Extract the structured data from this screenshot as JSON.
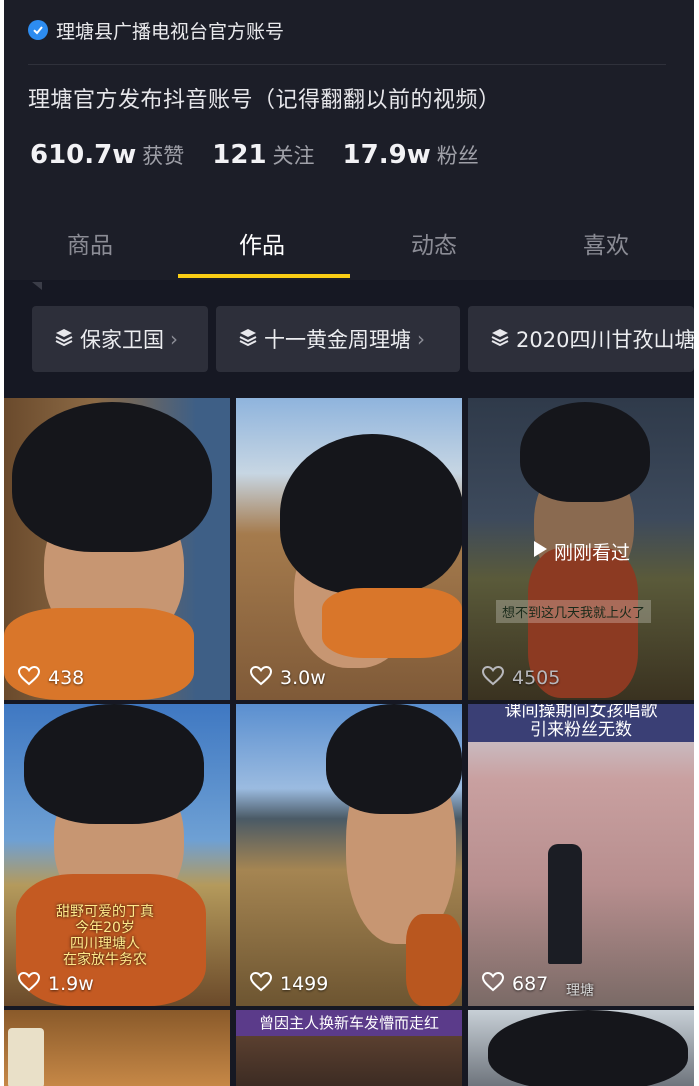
{
  "profile": {
    "name": "理塘县广播电视台官方账号",
    "bio": "理塘官方发布抖音账号（记得翻翻以前的视频）",
    "stats": [
      {
        "num": "610.7w",
        "label": "获赞"
      },
      {
        "num": "121",
        "label": "关注"
      },
      {
        "num": "17.9w",
        "label": "粉丝"
      }
    ]
  },
  "tabs": [
    "商品",
    "作品",
    "动态",
    "喜欢"
  ],
  "active_tab": "作品",
  "collections": [
    "保家卫国",
    "十一黄金周理塘",
    "2020四川甘孜山塘"
  ],
  "videos": [
    {
      "likes": "438"
    },
    {
      "likes": "3.0w"
    },
    {
      "likes": "4505",
      "tag": "刚刚看过",
      "caption": "想不到这几天我就上火了"
    },
    {
      "likes": "1.9w",
      "caption": "甜野可爱的丁真\n今年20岁\n四川理塘人\n在家放牛务农"
    },
    {
      "likes": "1499"
    },
    {
      "likes": "687",
      "banner": "课间操期间女孩唱歌\n引来粉丝无数",
      "caption": "理塘"
    },
    {
      "banner": "曾因主人换新车发懵而走红"
    }
  ],
  "colors": {
    "accent": "#face15",
    "verified": "#2d8cf0",
    "background": "#161823"
  }
}
